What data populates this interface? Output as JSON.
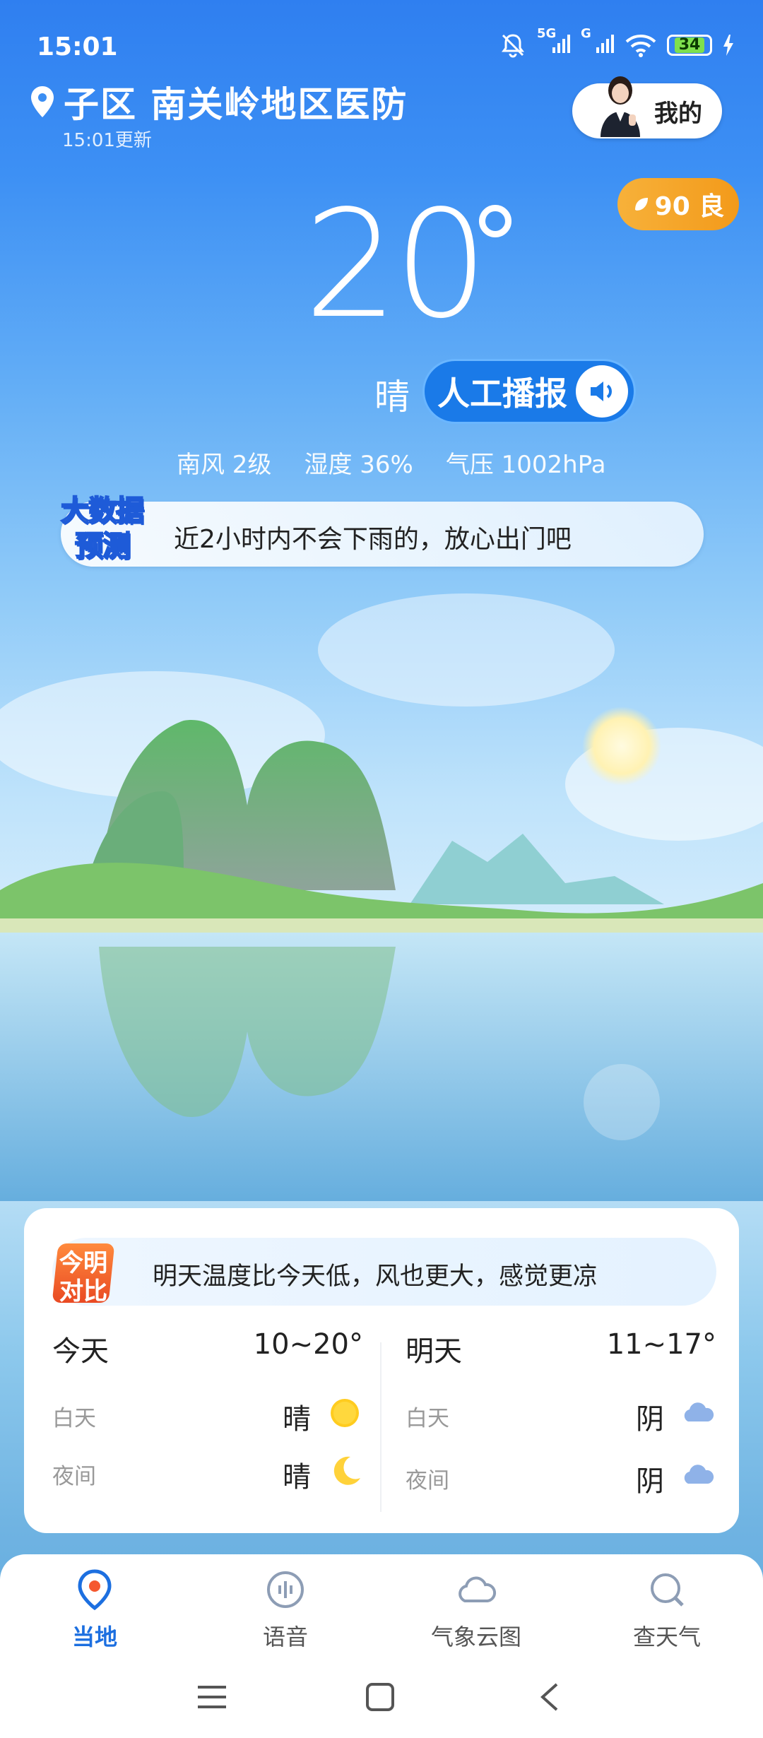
{
  "status_bar": {
    "time": "15:01",
    "network_1": "5G",
    "network_2": "G",
    "battery": "34"
  },
  "header": {
    "location": "子区 南关岭地区医防",
    "update_time": "15:01更新",
    "mine_label": "我的",
    "aqi": "90 良"
  },
  "weather": {
    "temperature": "20",
    "condition": "晴",
    "broadcast_label": "人工播报",
    "wind": "南风 2级",
    "humidity": "湿度 36%",
    "pressure": "气压 1002hPa"
  },
  "bigdata": {
    "logo_line1": "大数据",
    "logo_line2": "预测",
    "message": "近2小时内不会下雨的，放心出门吧"
  },
  "forecast_card": {
    "compare_logo_1": "今明",
    "compare_logo_2": "对比",
    "compare_text": "明天温度比今天低，风也更大，感觉更凉",
    "today": {
      "label": "今天",
      "range": "10~20°",
      "day_label": "白天",
      "day_cond": "晴",
      "day_icon": "sun-icon",
      "night_label": "夜间",
      "night_cond": "晴",
      "night_icon": "moon-icon"
    },
    "tomorrow": {
      "label": "明天",
      "range": "11~17°",
      "day_label": "白天",
      "day_cond": "阴",
      "day_icon": "cloud-icon",
      "night_label": "夜间",
      "night_cond": "阴",
      "night_icon": "cloud-icon"
    }
  },
  "bottom_nav": {
    "items": [
      {
        "label": "当地",
        "icon": "location-pin-icon",
        "active": true
      },
      {
        "label": "语音",
        "icon": "voice-icon",
        "active": false
      },
      {
        "label": "气象云图",
        "icon": "cloud-map-icon",
        "active": false
      },
      {
        "label": "查天气",
        "icon": "search-weather-icon",
        "active": false
      }
    ]
  },
  "colors": {
    "accent": "#1c6fe0",
    "aqi": "#f39a1a",
    "sky_top": "#2f7ff0"
  }
}
